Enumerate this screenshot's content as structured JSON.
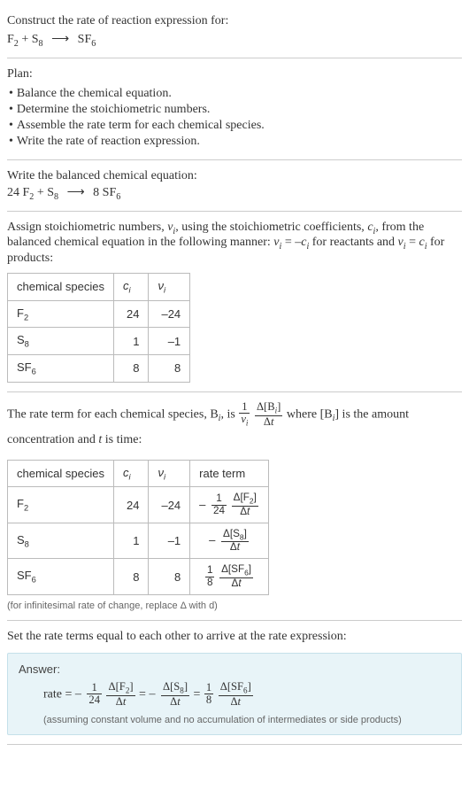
{
  "header": {
    "prompt": "Construct the rate of reaction expression for:",
    "eq_lhs1_base": "F",
    "eq_lhs1_sub": "2",
    "plus": "+",
    "eq_lhs2_base": "S",
    "eq_lhs2_sub": "8",
    "arrow": "⟶",
    "eq_rhs_base": "SF",
    "eq_rhs_sub": "6"
  },
  "plan": {
    "title": "Plan:",
    "items": [
      "Balance the chemical equation.",
      "Determine the stoichiometric numbers.",
      "Assemble the rate term for each chemical species.",
      "Write the rate of reaction expression."
    ],
    "bullet": "•"
  },
  "balanced": {
    "title": "Write the balanced chemical equation:",
    "c1": "24",
    "s1b": "F",
    "s1s": "2",
    "plus": "+",
    "s2b": "S",
    "s2s": "8",
    "arrow": "⟶",
    "c3": "8",
    "s3b": "SF",
    "s3s": "6"
  },
  "stoich": {
    "intro_a": "Assign stoichiometric numbers, ",
    "nu_i": "ν",
    "nu_sub": "i",
    "intro_b": ", using the stoichiometric coefficients, ",
    "c_i": "c",
    "c_sub": "i",
    "intro_c": ", from the balanced chemical equation in the following manner: ",
    "rel1_lhs_v": "ν",
    "rel1_lhs_sub": "i",
    "eq": " = ",
    "rel1_rhs_neg": "–",
    "rel1_rhs_c": "c",
    "rel1_rhs_sub": "i",
    "for_reactants": " for reactants and ",
    "rel2_lhs_v": "ν",
    "rel2_lhs_sub": "i",
    "rel2_rhs_c": "c",
    "rel2_rhs_sub": "i",
    "for_products": " for products:",
    "h_species": "chemical species",
    "h_ci": "c",
    "h_ci_sub": "i",
    "h_vi": "ν",
    "h_vi_sub": "i",
    "rows": [
      {
        "sb": "F",
        "ss": "2",
        "c": "24",
        "v": "–24"
      },
      {
        "sb": "S",
        "ss": "8",
        "c": "1",
        "v": "–1"
      },
      {
        "sb": "SF",
        "ss": "6",
        "c": "8",
        "v": "8"
      }
    ]
  },
  "rateterm": {
    "intro_a": "The rate term for each chemical species, B",
    "Bi_sub": "i",
    "intro_b": ", is ",
    "frac1_top": "1",
    "frac1_bot_v": "ν",
    "frac1_bot_sub": "i",
    "frac2_top_d": "Δ[B",
    "frac2_top_sub": "i",
    "frac2_top_close": "]",
    "frac2_bot_d": "Δ",
    "frac2_bot_t": "t",
    "intro_c": " where [B",
    "intro_c_sub": "i",
    "intro_d": "] is the amount concentration and ",
    "t_var": "t",
    "intro_e": " is time:",
    "h_species": "chemical species",
    "h_ci": "c",
    "h_ci_sub": "i",
    "h_vi": "ν",
    "h_vi_sub": "i",
    "h_rate": "rate term",
    "rows": [
      {
        "sb": "F",
        "ss": "2",
        "c": "24",
        "v": "–24",
        "neg": "–",
        "coef_top": "1",
        "coef_bot": "24",
        "conc_b": "F",
        "conc_s": "2"
      },
      {
        "sb": "S",
        "ss": "8",
        "c": "1",
        "v": "–1",
        "neg": "–",
        "coef_top": "",
        "coef_bot": "",
        "conc_b": "S",
        "conc_s": "8"
      },
      {
        "sb": "SF",
        "ss": "6",
        "c": "8",
        "v": "8",
        "neg": "",
        "coef_top": "1",
        "coef_bot": "8",
        "conc_b": "SF",
        "conc_s": "6"
      }
    ],
    "delta": "Δ",
    "t": "t",
    "note": "(for infinitesimal rate of change, replace Δ with d)"
  },
  "final": {
    "intro": "Set the rate terms equal to each other to arrive at the rate expression:",
    "answer_label": "Answer:",
    "rate_word": "rate",
    "eq": " = ",
    "neg": "–",
    "f1_top": "1",
    "f1_bot": "24",
    "c1_b": "F",
    "c1_s": "2",
    "c2_b": "S",
    "c2_s": "8",
    "f3_top": "1",
    "f3_bot": "8",
    "c3_b": "SF",
    "c3_s": "6",
    "delta": "Δ",
    "t": "t",
    "note": "(assuming constant volume and no accumulation of intermediates or side products)"
  },
  "chart_data": {
    "type": "table",
    "tables": [
      {
        "title": "stoichiometric numbers",
        "columns": [
          "chemical species",
          "c_i",
          "ν_i"
        ],
        "rows": [
          [
            "F2",
            24,
            -24
          ],
          [
            "S8",
            1,
            -1
          ],
          [
            "SF6",
            8,
            8
          ]
        ]
      },
      {
        "title": "rate terms",
        "columns": [
          "chemical species",
          "c_i",
          "ν_i",
          "rate term"
        ],
        "rows": [
          [
            "F2",
            24,
            -24,
            "-(1/24) Δ[F2]/Δt"
          ],
          [
            "S8",
            1,
            -1,
            "- Δ[S8]/Δt"
          ],
          [
            "SF6",
            8,
            8,
            "(1/8) Δ[SF6]/Δt"
          ]
        ]
      }
    ]
  }
}
